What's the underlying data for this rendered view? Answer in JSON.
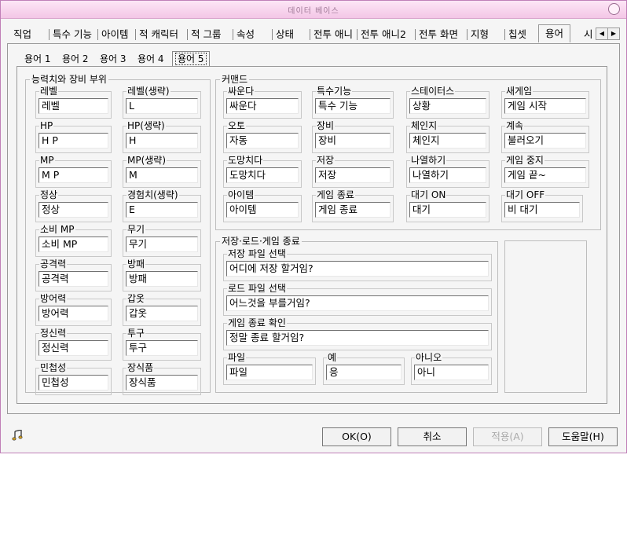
{
  "window": {
    "title": "데이터 베이스"
  },
  "tabs": [
    "직업",
    "특수 기능",
    "아이템",
    "적 캐릭터",
    "적 그룹",
    "속성",
    "상태",
    "전투 애니",
    "전투 애니2",
    "전투 화면",
    "지형",
    "칩셋",
    "용어",
    "시"
  ],
  "active_tab": "용어",
  "subtabs": [
    "용어 1",
    "용어 2",
    "용어 3",
    "용어 4",
    "용어 5"
  ],
  "active_subtab": "용어 5",
  "stats_group": {
    "title": "능력치와 장비 부위",
    "fields": [
      {
        "label": "레벨",
        "value": "레벨"
      },
      {
        "label": "레벨(생략)",
        "value": "L"
      },
      {
        "label": "HP",
        "value": "H P"
      },
      {
        "label": "HP(생략)",
        "value": "H"
      },
      {
        "label": "MP",
        "value": "M P"
      },
      {
        "label": "MP(생략)",
        "value": "M"
      },
      {
        "label": "정상",
        "value": "정상"
      },
      {
        "label": "경험치(생략)",
        "value": "E"
      },
      {
        "label": "소비 MP",
        "value": "소비 MP"
      },
      {
        "label": "무기",
        "value": "무기"
      },
      {
        "label": "공격력",
        "value": "공격력"
      },
      {
        "label": "방패",
        "value": "방패"
      },
      {
        "label": "방어력",
        "value": "방어력"
      },
      {
        "label": "갑옷",
        "value": "갑옷"
      },
      {
        "label": "정신력",
        "value": "정신력"
      },
      {
        "label": "투구",
        "value": "투구"
      },
      {
        "label": "민첩성",
        "value": "민첩성"
      },
      {
        "label": "장식품",
        "value": "장식품"
      }
    ]
  },
  "command_group": {
    "title": "커맨드",
    "fields": [
      {
        "label": "싸운다",
        "value": "싸운다"
      },
      {
        "label": "특수기능",
        "value": "특수 기능"
      },
      {
        "label": "스테이터스",
        "value": "상황"
      },
      {
        "label": "새게임",
        "value": "게임 시작"
      },
      {
        "label": "오토",
        "value": "자동"
      },
      {
        "label": "장비",
        "value": "장비"
      },
      {
        "label": "체인지",
        "value": "체인지"
      },
      {
        "label": "계속",
        "value": "불러오기"
      },
      {
        "label": "도망치다",
        "value": "도망치다"
      },
      {
        "label": "저장",
        "value": "저장"
      },
      {
        "label": "나열하기",
        "value": "나열하기"
      },
      {
        "label": "게임 중지",
        "value": "게임 끝~"
      },
      {
        "label": "아이템",
        "value": "아이템"
      },
      {
        "label": "게임 종료",
        "value": "게임 종료"
      },
      {
        "label": "대기 ON",
        "value": "대기"
      },
      {
        "label": "대기 OFF",
        "value": "비 대기"
      }
    ]
  },
  "save_group": {
    "title": "저장·로드·게임 종료",
    "wide_fields": [
      {
        "label": "저장 파일 선택",
        "value": "어디에 저장 할거임?"
      },
      {
        "label": "로드 파일 선택",
        "value": "어느것을 부를거임?"
      },
      {
        "label": "게임 종료 확인",
        "value": "정말 종료 할거임?"
      }
    ],
    "small_fields": [
      {
        "label": "파일",
        "value": "파일"
      },
      {
        "label": "예",
        "value": "응"
      },
      {
        "label": "아니오",
        "value": "아니"
      }
    ]
  },
  "buttons": {
    "ok": "OK(O)",
    "cancel": "취소",
    "apply": "적용(A)",
    "help": "도움말(H)"
  },
  "icons": {
    "music": "music-note-icon",
    "close": "close-icon"
  }
}
